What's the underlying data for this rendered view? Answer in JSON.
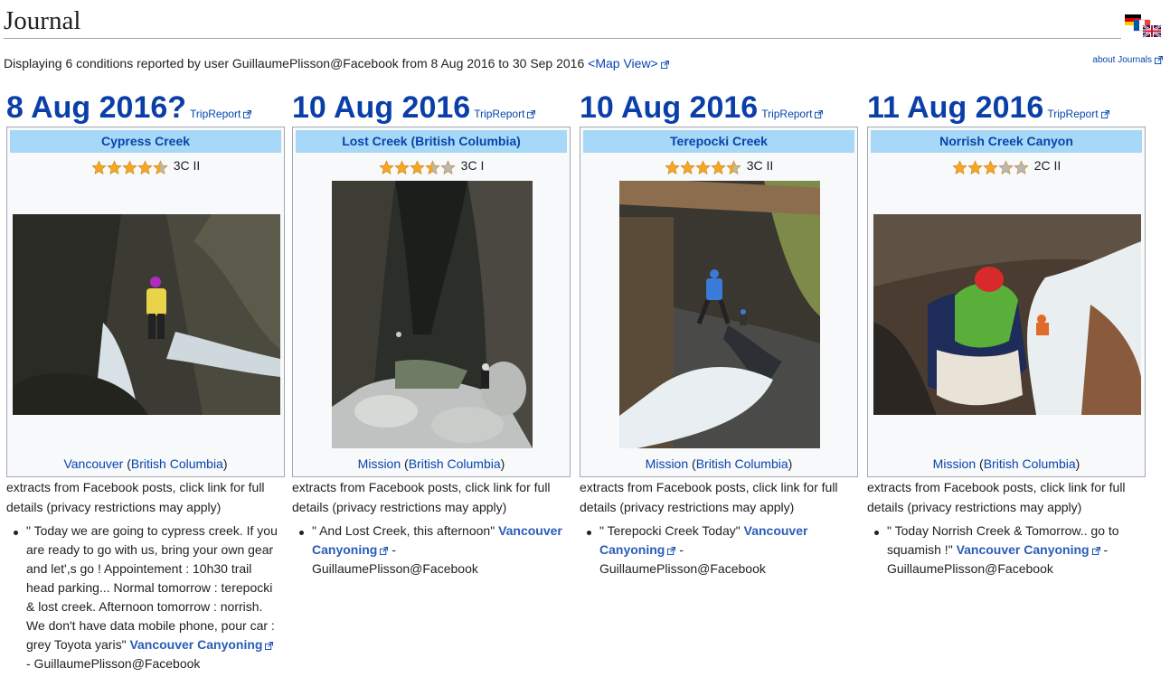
{
  "page": {
    "title": "Journal",
    "subtitle": "Displaying 6 conditions reported by user GuillaumePlisson@Facebook from 8 Aug 2016 to 30 Sep 2016",
    "map_view": "<Map View>",
    "about": "about Journals",
    "flags_icon": "language-flags-icon"
  },
  "entries": [
    {
      "date": "8 Aug 2016?",
      "trip_report": "TripReport",
      "canyon": "Cypress Creek",
      "rating_stars": 4.5,
      "rating_text": "3C II",
      "location": "Vancouver",
      "region": "British Columbia",
      "extracts": "extracts from Facebook posts, click link for full details (privacy restrictions may apply)",
      "quote": "\" Today we are going to cypress creek. If you are ready to go with us, bring your own gear and let',s go ! Appointement : 10h30 trail head parking... Normal tomorrow : terepocki & lost creek. Afternoon tomorrow : norrish. We don't have data mobile phone, pour car : grey Toyota yaris\"",
      "source_link": "Vancouver Canyoning",
      "author": "- GuillaumePlisson@Facebook"
    },
    {
      "date": "10 Aug 2016",
      "trip_report": "TripReport",
      "canyon": "Lost Creek (British Columbia)",
      "rating_stars": 3.5,
      "rating_text": "3C I",
      "location": "Mission",
      "region": "British Columbia",
      "extracts": "extracts from Facebook posts, click link for full details (privacy restrictions may apply)",
      "quote": "\" And Lost Creek, this afternoon\"",
      "source_link": "Vancouver Canyoning",
      "author": "- GuillaumePlisson@Facebook"
    },
    {
      "date": "10 Aug 2016",
      "trip_report": "TripReport",
      "canyon": "Terepocki Creek",
      "rating_stars": 4.5,
      "rating_text": "3C II",
      "location": "Mission",
      "region": "British Columbia",
      "extracts": "extracts from Facebook posts, click link for full details (privacy restrictions may apply)",
      "quote": "\" Terepocki Creek Today\"",
      "source_link": "Vancouver Canyoning",
      "author": "- GuillaumePlisson@Facebook"
    },
    {
      "date": "11 Aug 2016",
      "trip_report": "TripReport",
      "canyon": "Norrish Creek Canyon",
      "rating_stars": 3,
      "rating_text": "2C II",
      "location": "Mission",
      "region": "British Columbia",
      "extracts": "extracts from Facebook posts, click link for full details (privacy restrictions may apply)",
      "quote": "\" Today Norrish Creek & Tomorrow.. go to squamish !\"",
      "source_link": "Vancouver Canyoning",
      "author": "- GuillaumePlisson@Facebook"
    }
  ],
  "colors": {
    "date": "#0b3fa8",
    "link": "#0645ad",
    "canyon_header_bg": "#a8d8f8",
    "star_gold": "#f5a623",
    "star_grey": "#b8b8b8"
  }
}
